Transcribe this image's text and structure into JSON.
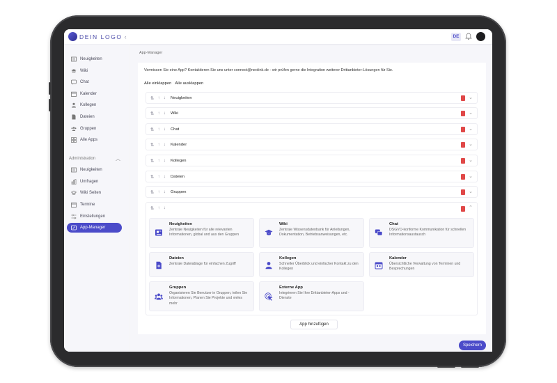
{
  "app": {
    "logo_text": "DEIN LOGO",
    "collapse_glyph": "‹",
    "language": "DE",
    "brand_color": "#4b4bc9"
  },
  "sidebar": {
    "items": [
      {
        "label": "Neuigkeiten",
        "icon": "newspaper-icon"
      },
      {
        "label": "Wiki",
        "icon": "graduation-cap-icon"
      },
      {
        "label": "Chat",
        "icon": "chat-bubble-icon"
      },
      {
        "label": "Kalender",
        "icon": "calendar-icon"
      },
      {
        "label": "Kollegen",
        "icon": "person-icon"
      },
      {
        "label": "Dateien",
        "icon": "file-icon"
      },
      {
        "label": "Gruppen",
        "icon": "group-icon"
      },
      {
        "label": "Alle Apps",
        "icon": "grid-icon"
      }
    ],
    "admin_label": "Administration",
    "admin_chevron": "︿",
    "admin_items": [
      {
        "label": "Neuigkeiten",
        "icon": "newspaper-icon"
      },
      {
        "label": "Umfragen",
        "icon": "chart-icon"
      },
      {
        "label": "Wiki Seiten",
        "icon": "graduation-cap-icon"
      },
      {
        "label": "Termine",
        "icon": "calendar-icon"
      },
      {
        "label": "Einstellungen",
        "icon": "sliders-icon"
      },
      {
        "label": "App-Manager",
        "icon": "app-manager-icon",
        "active": true
      }
    ]
  },
  "page": {
    "breadcrumb": "App-Manager",
    "intro": "Vermissen Sie eine App? Kontaktieren Sie uns unter connect@neolink.de - wir prüfen gerne die Integration weiterer Drittanbieter-Lösungen für Sie.",
    "collapse_all": "Alle einklappen",
    "expand_all": "Alle ausklappen"
  },
  "rows": [
    {
      "name": "Neuigkeiten"
    },
    {
      "name": "Wiki"
    },
    {
      "name": "Chat"
    },
    {
      "name": "Kalender"
    },
    {
      "name": "Kollegen"
    },
    {
      "name": "Dateien"
    },
    {
      "name": "Gruppen"
    },
    {
      "name": ""
    }
  ],
  "handles": {
    "sort": "⇅",
    "up": "↑",
    "down": "↓",
    "caret_down": "⌄",
    "caret_up": "⌃"
  },
  "cards": [
    {
      "title": "Neuigkeiten",
      "desc": "Zentrale Neuigkeiten für alle relevanten Informationen, global und aus den Gruppen",
      "icon": "newspaper-icon"
    },
    {
      "title": "Wiki",
      "desc": "Zentrale Wissensdatenbank für Anleitungen, Dokumentation, Betriebsanweisungen, etc.",
      "icon": "graduation-cap-icon"
    },
    {
      "title": "Chat",
      "desc": "DSGVO-konforme Kommunikation für schnellen Informationsaustausch",
      "icon": "chat-bubble-icon"
    },
    {
      "title": "Dateien",
      "desc": "Zentrale Dateiablage für einfachen Zugriff",
      "icon": "file-add-icon"
    },
    {
      "title": "Kollegen",
      "desc": "Schneller Überblick und einfacher Kontakt zu den Kollegen",
      "icon": "person-icon"
    },
    {
      "title": "Kalender",
      "desc": "Übersichtliche Verwaltung von Terminen und Besprechungen",
      "icon": "calendar-icon"
    },
    {
      "title": "Gruppen",
      "desc": "Organisieren Sie Benutzer in Gruppen, teilen Sie Informationen, Planen Sie Projekte und vieles mehr",
      "icon": "group-icon"
    },
    {
      "title": "Externe App",
      "desc": "Integrieren Sie Ihre Drittanbieter-Apps und -Dienste",
      "icon": "pointer-icon"
    }
  ],
  "actions": {
    "add_app": "App hinzufügen",
    "save": "Speichern"
  }
}
